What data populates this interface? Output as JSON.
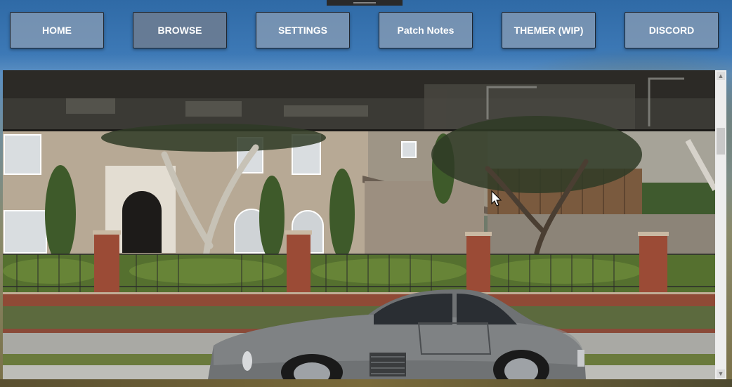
{
  "nav": {
    "items": [
      {
        "label": "HOME"
      },
      {
        "label": "BROWSE"
      },
      {
        "label": "SETTINGS"
      },
      {
        "label": "Patch Notes"
      },
      {
        "label": "THEMER (WIP)"
      },
      {
        "label": "DISCORD"
      }
    ],
    "active": "BROWSE"
  },
  "viewer": {
    "content": "in-game screenshot: silver classic gull-wing coupe parked on a residential street in front of a brick-pillared fence, hedges, trees and houses"
  },
  "icons": {
    "scroll_up": "scroll-up-arrow-icon",
    "scroll_down": "scroll-down-arrow-icon",
    "cursor": "mouse-pointer-icon"
  },
  "colors": {
    "nav_button_bg": "#879bb4",
    "nav_button_text": "#ffffff",
    "background_sky": "#3d79b6"
  }
}
